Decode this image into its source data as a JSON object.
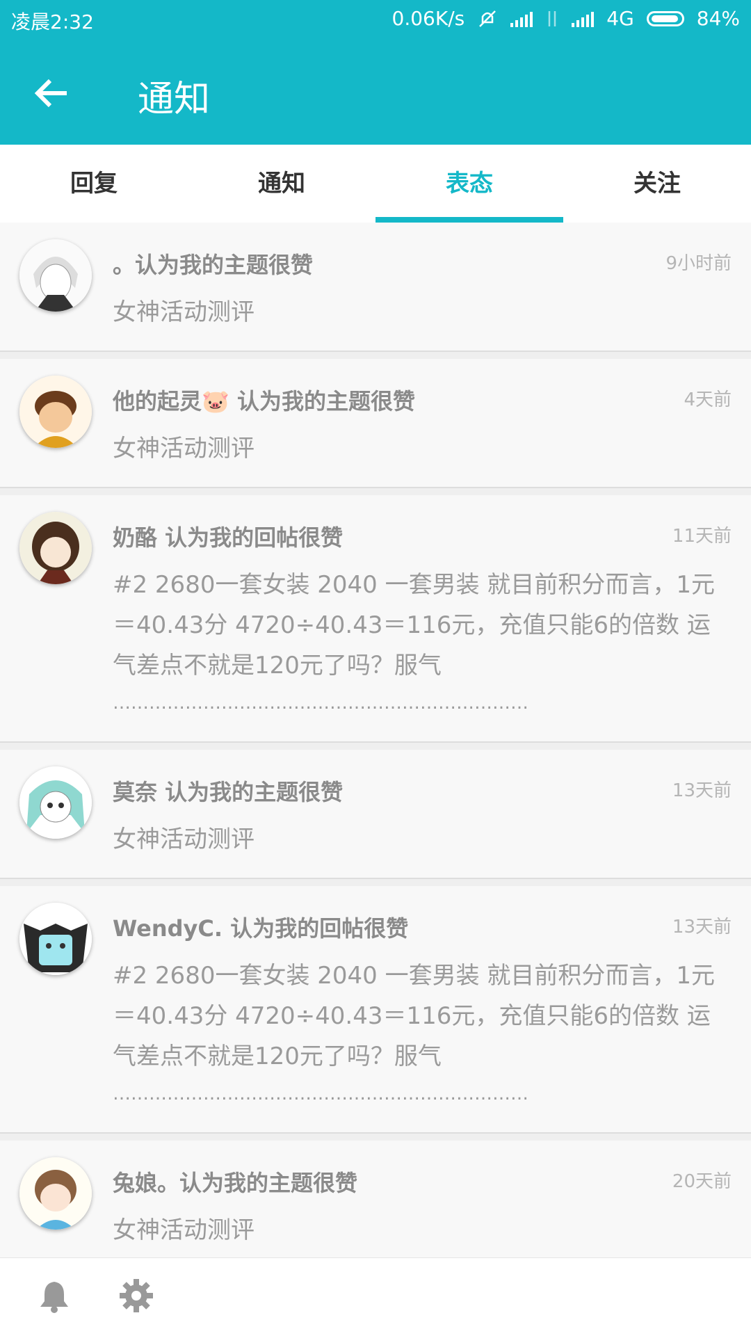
{
  "status": {
    "time": "凌晨2:32",
    "speed": "0.06K/s",
    "network": "4G",
    "battery": "84%"
  },
  "appbar": {
    "title": "通知"
  },
  "tabs": [
    {
      "label": "回复"
    },
    {
      "label": "通知"
    },
    {
      "label": "表态"
    },
    {
      "label": "关注"
    }
  ],
  "items": [
    {
      "who": "。认为我的主题很赞",
      "time": "9小时前",
      "content": "女神活动测评"
    },
    {
      "who": "他的起灵🐷 认为我的主题很赞",
      "time": "4天前",
      "content": "女神活动测评"
    },
    {
      "who": "奶酪 认为我的回帖很赞",
      "time": "11天前",
      "content": "#2 2680一套女装 2040 一套男装 就目前积分而言，1元＝40.43分 4720÷40.43＝116元，充值只能6的倍数 运气差点不就是120元了吗？服气",
      "dots": "……………………………………………………………"
    },
    {
      "who": "莫奈 认为我的主题很赞",
      "time": "13天前",
      "content": "女神活动测评"
    },
    {
      "who": "WendyC. 认为我的回帖很赞",
      "time": "13天前",
      "content": "#2 2680一套女装 2040 一套男装 就目前积分而言，1元＝40.43分 4720÷40.43＝116元，充值只能6的倍数 运气差点不就是120元了吗？服气",
      "dots": "……………………………………………………………"
    },
    {
      "who": "兔娘。认为我的主题很赞",
      "time": "20天前",
      "content": "女神活动测评"
    }
  ],
  "colors": {
    "accent": "#14b8c8"
  },
  "icons": {
    "back": "arrow-left-icon",
    "bell": "bell-icon",
    "settings": "gear-icon"
  }
}
